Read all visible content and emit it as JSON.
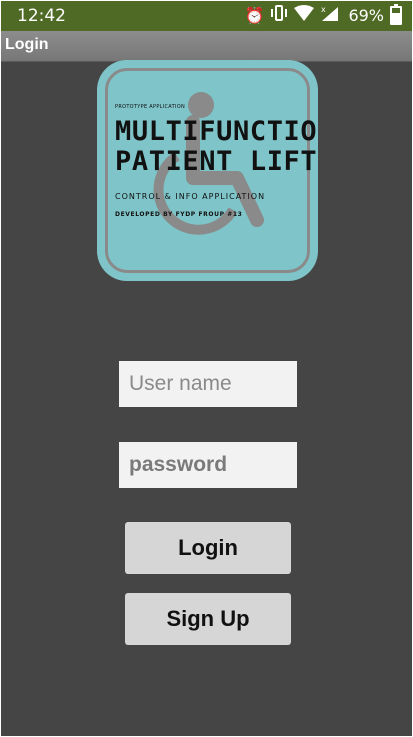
{
  "status_bar": {
    "time": "12:42",
    "battery": "69%",
    "icons": [
      "alarm-icon",
      "vibrate-icon",
      "wifi-icon",
      "signal-icon",
      "battery-icon"
    ]
  },
  "app_bar": {
    "title": "Login"
  },
  "logo": {
    "prototype": "PROTOTYPE APPLICATION",
    "title_line1": "MULTIFUNCTION",
    "title_line2": "PATIENT LIFT",
    "subtitle": "CONTROL & INFO APPLICATION",
    "developed_by": "DEVELOPED BY FYDP FROUP #13"
  },
  "form": {
    "username_placeholder": "User name",
    "password_placeholder": "password",
    "login_label": "Login",
    "signup_label": "Sign Up"
  },
  "colors": {
    "status_bar": "#4f6a24",
    "background": "#454545",
    "logo_bg": "#7ec4c8",
    "button": "#d6d6d6"
  }
}
